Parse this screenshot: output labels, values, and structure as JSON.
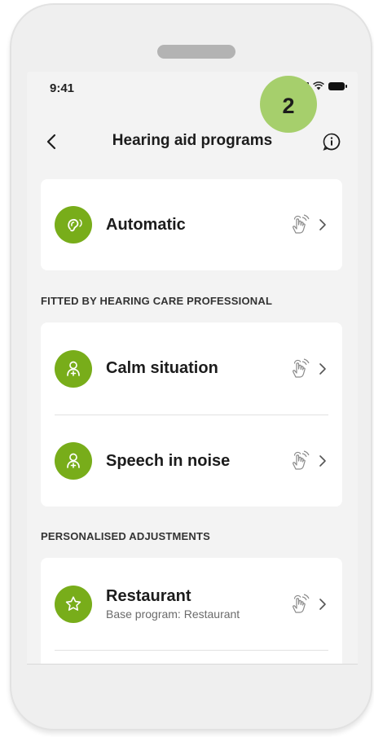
{
  "status_bar": {
    "time": "9:41"
  },
  "step_badge": "2",
  "header": {
    "title": "Hearing aid programs"
  },
  "automatic": {
    "title": "Automatic",
    "icon": "ear-icon"
  },
  "fitted": {
    "header": "FITTED BY HEARING CARE PROFESSIONAL",
    "items": [
      {
        "title": "Calm situation",
        "icon": "person-plus-icon"
      },
      {
        "title": "Speech in noise",
        "icon": "person-plus-icon"
      }
    ]
  },
  "personalised": {
    "header": "PERSONALISED ADJUSTMENTS",
    "items": [
      {
        "title": "Restaurant",
        "subtitle": "Base program: Restaurant",
        "icon": "star-icon"
      }
    ]
  },
  "colors": {
    "accent": "#78ad1a",
    "badge": "#a6cf6c",
    "background": "#f3f3f3"
  }
}
